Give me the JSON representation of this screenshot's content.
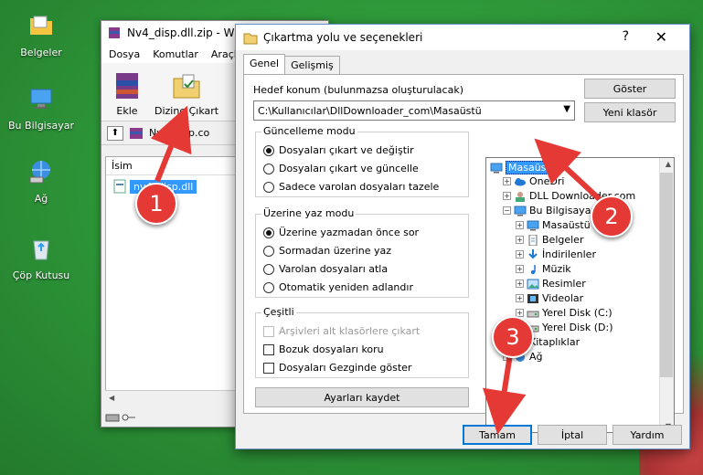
{
  "desktop": {
    "icons": [
      {
        "label": "Belgeler"
      },
      {
        "label": "Bu Bilgisayar"
      },
      {
        "label": "Ağ"
      },
      {
        "label": "Çöp Kutusu"
      }
    ]
  },
  "winrar": {
    "title": "Nv4_disp.dll.zip - W",
    "menu": [
      "Dosya",
      "Komutlar",
      "Araçla"
    ],
    "toolbar": {
      "add": "Ekle",
      "extract_to": "Dizine Çıkart"
    },
    "path": "Nv4_disp.co",
    "column_name": "İsim",
    "file": "nv4_disp.dll"
  },
  "dialog": {
    "title": "Çıkartma yolu ve seçenekleri",
    "help_glyph": "?",
    "close_glyph": "✕",
    "tabs": [
      "Genel",
      "Gelişmiş"
    ],
    "dest_label": "Hedef konum (bulunmazsa oluşturulacak)",
    "dest_value": "C:\\Kullanıcılar\\DllDownloader_com\\Masaüstü",
    "show_button": "Göster",
    "new_folder_button": "Yeni klasör",
    "update_mode": {
      "title": "Güncelleme modu",
      "options": [
        "Dosyaları çıkart ve değiştir",
        "Dosyaları çıkart ve güncelle",
        "Sadece varolan dosyaları tazele"
      ],
      "selected": 0
    },
    "overwrite_mode": {
      "title": "Üzerine yaz modu",
      "options": [
        "Üzerine yazmadan önce sor",
        "Sormadan üzerine yaz",
        "Varolan dosyaları atla",
        "Otomatik yeniden adlandır"
      ],
      "selected": 0
    },
    "misc": {
      "title": "Çeşitli",
      "options": [
        {
          "label": "Arşivleri alt klasörlere çıkart",
          "checked": false,
          "disabled": true
        },
        {
          "label": "Bozuk dosyaları koru",
          "checked": false,
          "disabled": false
        },
        {
          "label": "Dosyaları Gezginde göster",
          "checked": false,
          "disabled": false
        }
      ]
    },
    "save_settings": "Ayarları kaydet",
    "tree": [
      {
        "label": "Masaüstü",
        "level": 0,
        "selected": true,
        "icon": "desktop-icon"
      },
      {
        "label": "OneDri",
        "level": 1,
        "icon": "cloud-icon"
      },
      {
        "label": "DLL Downloader.com",
        "level": 1,
        "icon": "user-icon"
      },
      {
        "label": "Bu Bilgisayar",
        "level": 1,
        "icon": "computer-icon"
      },
      {
        "label": "Masaüstü",
        "level": 2,
        "icon": "desktop-icon"
      },
      {
        "label": "Belgeler",
        "level": 2,
        "icon": "document-icon"
      },
      {
        "label": "İndirilenler",
        "level": 2,
        "icon": "download-icon"
      },
      {
        "label": "Müzik",
        "level": 2,
        "icon": "music-icon"
      },
      {
        "label": "Resimler",
        "level": 2,
        "icon": "image-icon"
      },
      {
        "label": "Videolar",
        "level": 2,
        "icon": "video-icon"
      },
      {
        "label": "Yerel Disk (C:)",
        "level": 2,
        "icon": "drive-icon"
      },
      {
        "label": "Yerel Disk (D:)",
        "level": 2,
        "icon": "drive-icon"
      },
      {
        "label": "Kitaplıklar",
        "level": 1,
        "icon": "folder-icon"
      },
      {
        "label": "Ağ",
        "level": 1,
        "icon": "network-icon"
      }
    ],
    "ok": "Tamam",
    "cancel": "İptal",
    "help": "Yardım"
  },
  "annotations": [
    "1",
    "2",
    "3"
  ],
  "colors": {
    "badge": "#e53935",
    "selection": "#3399ff"
  }
}
